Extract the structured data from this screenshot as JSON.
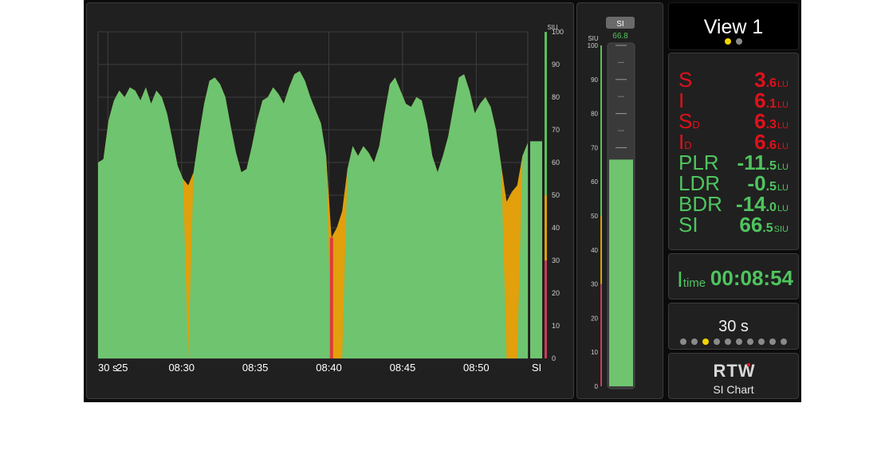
{
  "chart": {
    "siu_label": "SIU",
    "y_ticks": [
      100,
      90,
      80,
      70,
      60,
      50,
      40,
      30,
      20,
      10,
      0
    ],
    "x_ticks": [
      "30 s",
      "25",
      "08:30",
      "08:35",
      "08:40",
      "08:45",
      "08:50"
    ],
    "bar_label": "SI",
    "bar_value": 66.5
  },
  "chart_data": {
    "type": "area",
    "xlabel": "",
    "ylabel": "SIU",
    "ylim": [
      0,
      100
    ],
    "x_time_range": [
      "08:24:20",
      "08:53:30"
    ],
    "sample_interval_s": 20,
    "start_time": "08:24:20",
    "values": [
      60,
      61,
      73,
      79,
      82,
      80,
      83,
      82,
      79,
      83,
      78,
      82,
      80,
      75,
      67,
      59,
      55,
      53,
      57,
      68,
      78,
      85,
      86,
      84,
      80,
      71,
      63,
      57,
      58,
      65,
      73,
      79,
      80,
      83,
      81,
      78,
      83,
      87,
      88,
      85,
      80,
      76,
      72,
      62,
      37,
      40,
      45,
      58,
      65,
      62,
      65,
      63,
      60,
      65,
      75,
      84,
      86,
      82,
      78,
      77,
      80,
      79,
      72,
      62,
      57,
      62,
      68,
      77,
      86,
      87,
      82,
      75,
      78,
      80,
      77,
      70,
      59,
      48,
      51,
      53,
      62,
      66
    ],
    "series_colors": {
      "ok": "#6fc46f",
      "caution": "#e1a00c",
      "over": "#e03a3a"
    },
    "grid": true
  },
  "meter": {
    "title": "SI",
    "value": "66.8",
    "unit": "SIU",
    "ticks": [
      100,
      90,
      80,
      70,
      60,
      50,
      40,
      30,
      20,
      10,
      0
    ],
    "fill_value": 66.5,
    "peak_value": 66.8
  },
  "view": {
    "title": "View 1",
    "pages": 2,
    "active_page": 0
  },
  "values": [
    {
      "label": "S",
      "sub": "",
      "int": "3",
      "dec": ".6",
      "unit": "LU",
      "color": "#e0111b"
    },
    {
      "label": "I",
      "sub": "",
      "int": "6",
      "dec": ".1",
      "unit": "LU",
      "color": "#e0111b"
    },
    {
      "label": "S",
      "sub": "D",
      "int": "6",
      "dec": ".3",
      "unit": "LU",
      "color": "#e0111b"
    },
    {
      "label": "I",
      "sub": "D",
      "int": "6",
      "dec": ".6",
      "unit": "LU",
      "color": "#e0111b"
    },
    {
      "label": "PLR",
      "sub": "",
      "int": "-11",
      "dec": ".5",
      "unit": "LU",
      "color": "#4fc45f"
    },
    {
      "label": "LDR",
      "sub": "",
      "int": "-0",
      "dec": ".5",
      "unit": "LU",
      "color": "#4fc45f"
    },
    {
      "label": "BDR",
      "sub": "",
      "int": "-14",
      "dec": ".0",
      "unit": "LU",
      "color": "#4fc45f"
    },
    {
      "label": "SI",
      "sub": "",
      "int": "66",
      "dec": ".5",
      "unit": "SIU",
      "color": "#4fc45f"
    }
  ],
  "itime": {
    "label": "I",
    "sub": "time",
    "value": "00:08:54",
    "color": "#4fc45f"
  },
  "range": {
    "value": "30 s",
    "dots": 10,
    "active_dot": 2
  },
  "brand": {
    "logo": "RTW",
    "subtitle": "SI Chart"
  }
}
